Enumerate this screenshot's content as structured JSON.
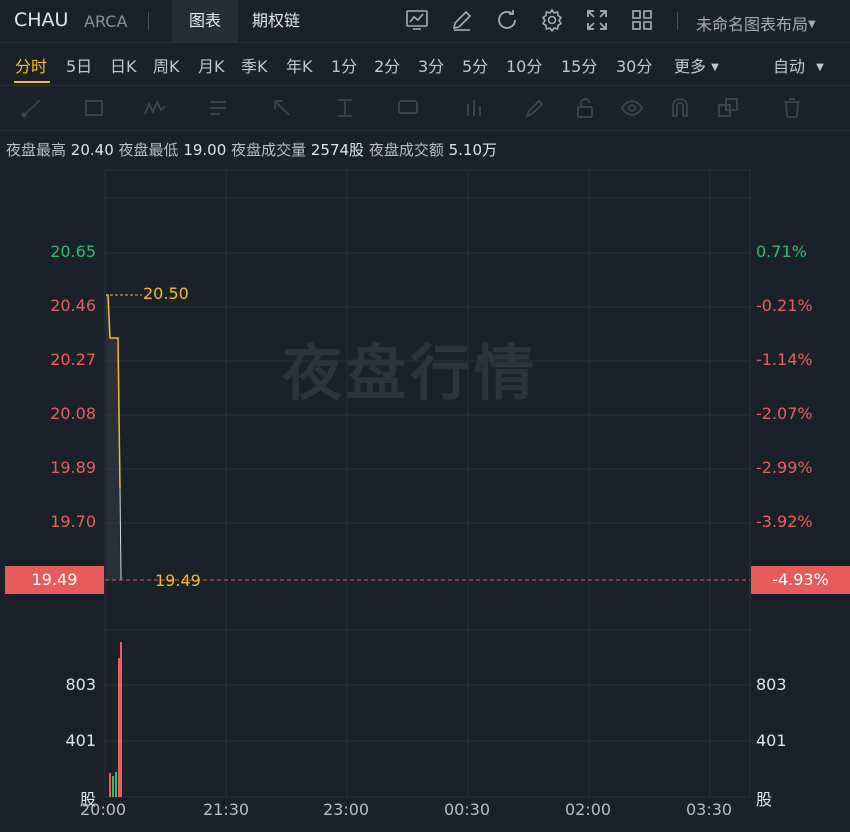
{
  "header": {
    "symbol": "CHAU",
    "exchange": "ARCA",
    "tab_chart": "图表",
    "tab_options": "期权链",
    "layout_name": "未命名图表布局",
    "icons": [
      "indicator-icon",
      "pen-icon",
      "refresh-icon",
      "settings-icon",
      "fullscreen-icon",
      "layout-grid-icon"
    ]
  },
  "periods": {
    "items": [
      "分时",
      "5日",
      "日K",
      "周K",
      "月K",
      "季K",
      "年K",
      "1分",
      "2分",
      "3分",
      "5分",
      "10分",
      "15分",
      "30分",
      "更多"
    ],
    "active": "分时",
    "auto_label": "自动"
  },
  "tools": [
    "line-tool-icon",
    "rectangle-tool-icon",
    "pattern-tool-icon",
    "text-list-tool-icon",
    "arrow-tool-icon",
    "measure-tool-icon",
    "annotation-tool-icon",
    "chart-type-icon",
    "brush-icon",
    "lock-icon",
    "eye-icon",
    "magnet-icon",
    "layers-icon",
    "trash-icon"
  ],
  "stats": {
    "high_label": "夜盘最高",
    "high_value": "20.40",
    "low_label": "夜盘最低",
    "low_value": "19.00",
    "volume_label": "夜盘成交量",
    "volume_value": "2574股",
    "turnover_label": "夜盘成交额",
    "turnover_value": "5.10万"
  },
  "chart": {
    "watermark": "夜盘行情",
    "price_axis_left": [
      "20.65",
      "20.46",
      "20.27",
      "20.08",
      "19.89",
      "19.70"
    ],
    "pct_axis_right": [
      "0.71%",
      "-0.21%",
      "-1.14%",
      "-2.07%",
      "-2.99%",
      "-3.92%"
    ],
    "current_price": "19.49",
    "current_pct": "-4.93%",
    "high_marker": "20.50",
    "low_marker": "19.49",
    "volume_axis_left": [
      "803",
      "401",
      "股"
    ],
    "volume_axis_right": [
      "803",
      "401",
      "股"
    ],
    "time_labels": [
      "20:00",
      "21:30",
      "23:00",
      "00:30",
      "02:00",
      "03:30"
    ],
    "colors": {
      "up": "#2fbf71",
      "down": "#e86060",
      "accent": "#f4bd28",
      "tag": "#e85b5b"
    }
  }
}
